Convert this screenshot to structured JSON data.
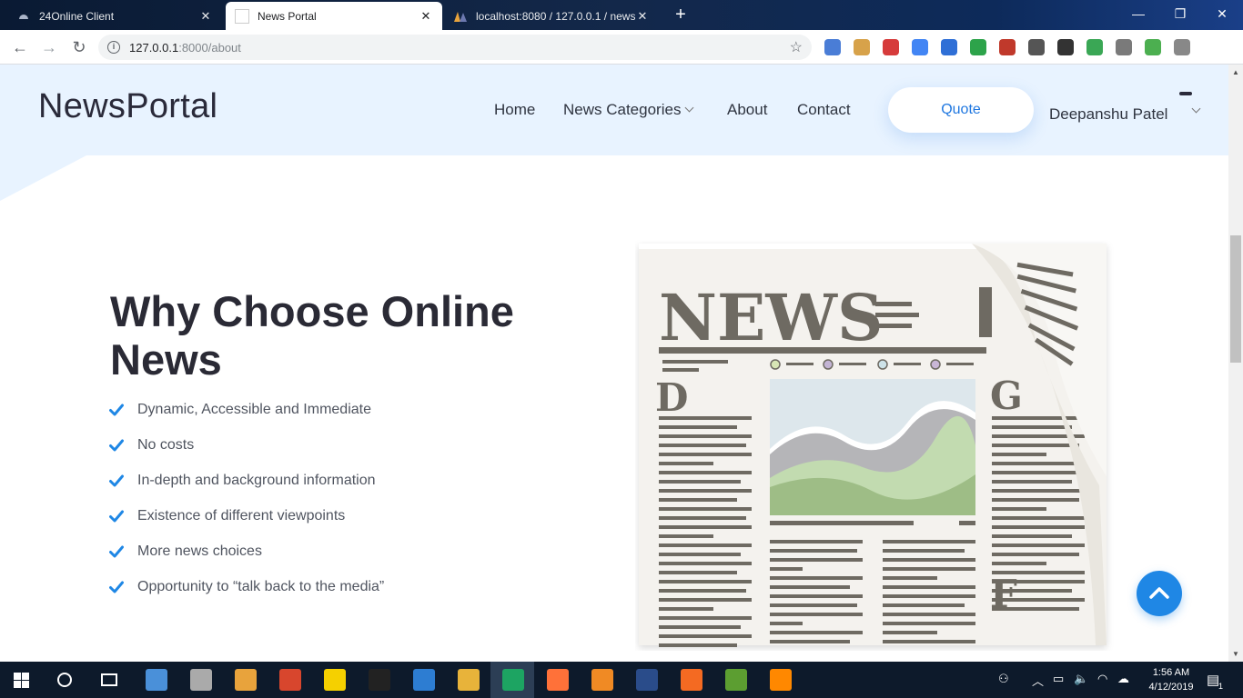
{
  "browser": {
    "tabs": [
      {
        "title": "24Online Client",
        "active": false
      },
      {
        "title": "News Portal",
        "active": true
      },
      {
        "title": "localhost:8080 / 127.0.0.1 / news",
        "active": false
      }
    ],
    "close_glyph": "✕",
    "new_tab_glyph": "+",
    "url": {
      "host": "127.0.0.1",
      "rest": ":8000/about"
    },
    "back_glyph": "←",
    "forward_glyph": "→",
    "reload_glyph": "↻",
    "window_controls": {
      "minimize": "—",
      "restore": "❐",
      "close": "✕"
    },
    "extensions": [
      "#4a7dd6",
      "#d7a24a",
      "#d63b3b",
      "#4285f4",
      "#2f6fd6",
      "#2da34a",
      "#c0392b",
      "#555555",
      "#333333",
      "#3aa755",
      "#7a7a7a",
      "#4caf50",
      "#888888"
    ]
  },
  "site": {
    "logo": "NewsPortal",
    "nav": {
      "home": "Home",
      "categories": "News Categories",
      "about": "About",
      "contact": "Contact"
    },
    "quote": "Quote",
    "user": "Deepanshu Patel"
  },
  "about": {
    "heading": "Why Choose Online News",
    "features": [
      "Dynamic, Accessible and Immediate",
      "No costs",
      "In-depth and background information",
      "Existence of different viewpoints",
      "More news choices",
      "Opportunity to “talk back to the media”"
    ]
  },
  "illustration": {
    "masthead": "NEWS",
    "drop_caps": [
      "D",
      "G",
      "F"
    ]
  },
  "colors": {
    "accent": "#1f87e5",
    "header_bg": "#e8f3ff"
  },
  "taskbar": {
    "time": "1:56 AM",
    "date": "4/12/2019",
    "notification_count": "1",
    "apps": [
      "#4a90d9",
      "#aaaaaa",
      "#e8a33c",
      "#d8462d",
      "#f5d000",
      "#222222",
      "#2d7dd2",
      "#e8b33a",
      "#1da462",
      "#ff7139",
      "#f08a24",
      "#2a4c8a",
      "#f46a22",
      "#5c9e31",
      "#ff8800"
    ]
  }
}
